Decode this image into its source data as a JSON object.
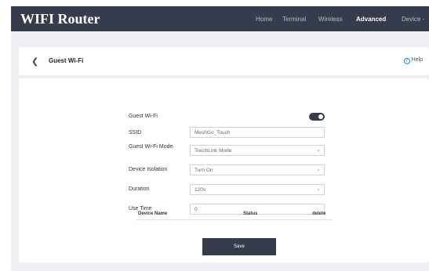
{
  "header": {
    "brand": "WIFI Router",
    "nav": [
      {
        "label": "Home"
      },
      {
        "label": "Terminal"
      },
      {
        "label": "Wireless"
      },
      {
        "label": "Advanced",
        "active": true
      },
      {
        "label": "Device -"
      }
    ]
  },
  "subheader": {
    "back_icon": "chevron-left-icon",
    "title": "Guest Wi-Fi",
    "help_label": "Help",
    "help_icon": "help-circle-icon"
  },
  "form": {
    "guest_wifi": {
      "label": "Guest Wi-Fi",
      "enabled": true
    },
    "ssid": {
      "label": "SSID",
      "value": "MeshGo_Touch"
    },
    "mode": {
      "label": "Guest Wi-Fi Mode",
      "value": "TouchLink Mode"
    },
    "isolation": {
      "label": "Device Isolation",
      "value": "Turn On"
    },
    "duration": {
      "label": "Duration",
      "value": "120s"
    },
    "use_time": {
      "label": "Use Time",
      "value": "0"
    }
  },
  "table": {
    "columns": [
      "Device Name",
      "Status",
      "delete"
    ]
  },
  "save_label": "Save",
  "colors": {
    "header_bg": "#363c4b",
    "page_bg": "#eff0f3",
    "accent": "#363c4b"
  }
}
